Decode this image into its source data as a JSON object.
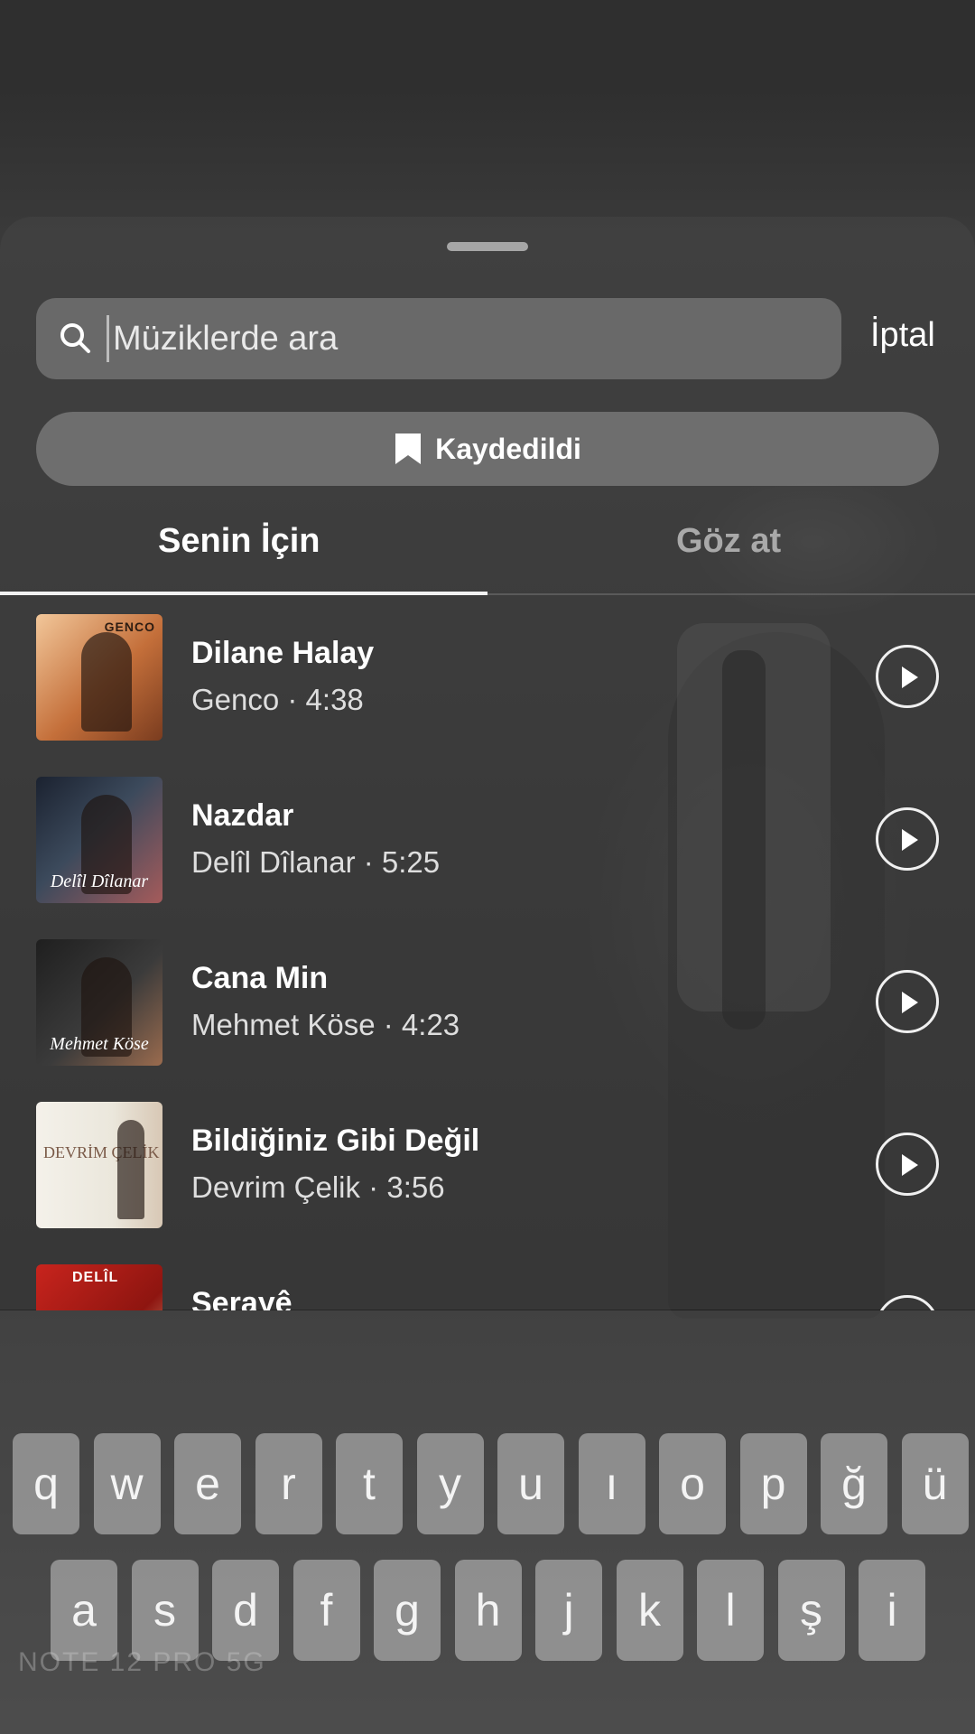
{
  "search": {
    "placeholder": "Müziklerde ara",
    "cancel_label": "İptal"
  },
  "saved_button": {
    "label": "Kaydedildi",
    "icon": "bookmark-icon"
  },
  "tabs": [
    {
      "label": "Senin İçin",
      "active": true
    },
    {
      "label": "Göz at",
      "active": false
    }
  ],
  "tracks": [
    {
      "title": "Dilane Halay",
      "meta": "Genco · 4:38",
      "cover_text": "",
      "cover_top": "GENCO"
    },
    {
      "title": "Nazdar",
      "meta": "Delîl Dîlanar · 5:25",
      "cover_text": "Delîl Dîlanar"
    },
    {
      "title": "Cana Min",
      "meta": "Mehmet Köse · 4:23",
      "cover_text": "Mehmet Köse"
    },
    {
      "title": "Bildiğiniz Gibi Değil",
      "meta": "Devrim Çelik · 3:56",
      "cover_text": "DEVRİM ÇELİK"
    },
    {
      "title": "Serayê",
      "meta": "",
      "cover_text": "DELÎL"
    }
  ],
  "keyboard": {
    "row1": [
      "q",
      "w",
      "e",
      "r",
      "t",
      "y",
      "u",
      "ı",
      "o",
      "p",
      "ğ",
      "ü"
    ],
    "row2": [
      "a",
      "s",
      "d",
      "f",
      "g",
      "h",
      "j",
      "k",
      "l",
      "ş",
      "i"
    ]
  },
  "watermark": "NOTE 12 PRO 5G",
  "colors": {
    "sheet": "#464646",
    "accent_text": "#ffffff",
    "inactive_tab": "#a9a9a9"
  }
}
